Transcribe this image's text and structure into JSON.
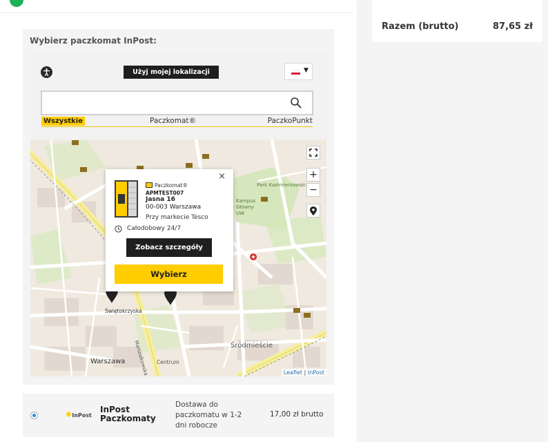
{
  "summary": {
    "total_label": "Razem (brutto)",
    "total_value": "87,65 zł"
  },
  "picker": {
    "title": "Wybierz paczkomat InPost:",
    "use_location_label": "Użyj mojej lokalizacji",
    "language": "PL",
    "search_placeholder": "",
    "filters": [
      "Wszystkie",
      "Paczkomat®",
      "PaczkoPunkt"
    ],
    "active_filter": "Wszystkie"
  },
  "map": {
    "labels": {
      "warszawa": "Warszawa",
      "srodmiescie": "Śródmieście",
      "swietokrzyska": "Świętokrzyska",
      "marszalkowska": "Marszałkowska",
      "centrum": "Centrum",
      "park": "Park Kazimierzowski",
      "kampus": "Kampus Główny UW"
    },
    "attribution_leaflet": "Leaflet",
    "attribution_sep": " | ",
    "attribution_inpost": "InPost",
    "zoom_in": "+",
    "zoom_out": "−"
  },
  "popup": {
    "type": "Paczkomat®",
    "code": "APMTEST007",
    "street": "Jasna 16",
    "city": "00-003 Warszawa",
    "description": "Przy markecie Tesco",
    "hours": "Całodobowy 24/7",
    "details_button": "Zobacz szczegóły",
    "choose_button": "Wybierz",
    "close": "×"
  },
  "shipping": {
    "logo_text": "InPost",
    "name": "InPost Paczkomaty",
    "description": "Dostawa do paczkomatu w 1-2 dni robocze",
    "price": "17,00 zł brutto",
    "selected": true
  },
  "colors": {
    "accent": "#ffcd00",
    "dark": "#1f1f1f",
    "success": "#1bb35a"
  }
}
